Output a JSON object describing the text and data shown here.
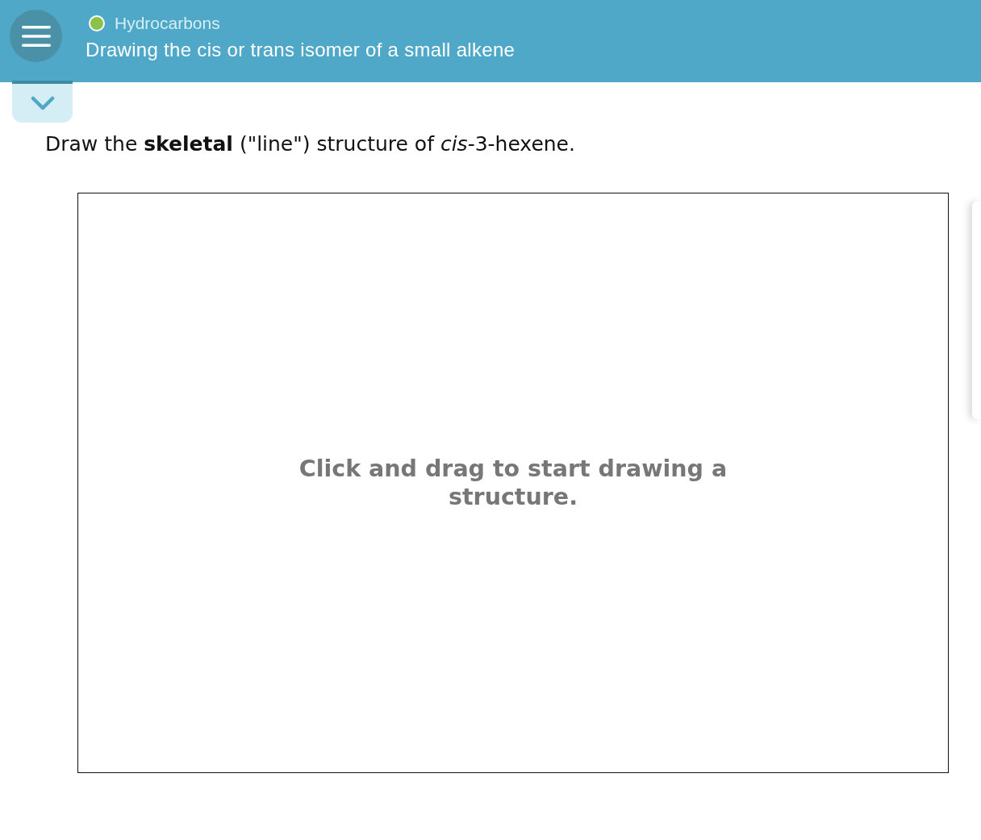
{
  "header": {
    "topic": "Hydrocarbons",
    "title": "Drawing the cis or trans isomer of a small alkene"
  },
  "details_toggle": {
    "expanded": false
  },
  "question": {
    "prompt": "Draw the **skeletal** (\"line\") structure of *cis*-3-hexene."
  },
  "drawing_canvas": {
    "placeholder": "Click and drag to start drawing a structure."
  }
}
